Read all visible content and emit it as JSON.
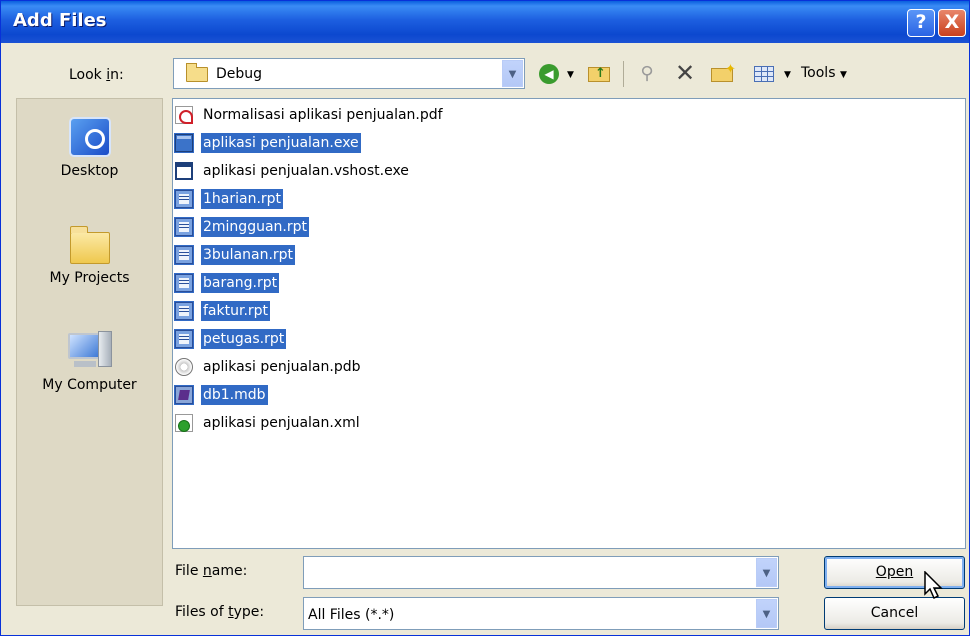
{
  "window": {
    "title": "Add Files"
  },
  "title_buttons": {
    "help": "?",
    "close": "X"
  },
  "look_in": {
    "label_pre": "Look ",
    "label_key": "i",
    "label_post": "n:",
    "value": "Debug"
  },
  "toolbar": {
    "tools_label": "Tools"
  },
  "places": [
    {
      "label": "Desktop",
      "icon": "desktop-icon"
    },
    {
      "label": "My Projects",
      "icon": "folder-icon"
    },
    {
      "label": "My Computer",
      "icon": "computer-icon"
    }
  ],
  "files": [
    {
      "name": "Normalisasi aplikasi penjualan.pdf",
      "type": "pdf",
      "selected": false
    },
    {
      "name": "aplikasi penjualan.exe",
      "type": "exe",
      "selected": true
    },
    {
      "name": "aplikasi penjualan.vshost.exe",
      "type": "vshost",
      "selected": false
    },
    {
      "name": "1harian.rpt",
      "type": "rpt",
      "selected": true
    },
    {
      "name": "2mingguan.rpt",
      "type": "rpt",
      "selected": true
    },
    {
      "name": "3bulanan.rpt",
      "type": "rpt",
      "selected": true
    },
    {
      "name": "barang.rpt",
      "type": "rpt",
      "selected": true
    },
    {
      "name": "faktur.rpt",
      "type": "rpt",
      "selected": true
    },
    {
      "name": "petugas.rpt",
      "type": "rpt",
      "selected": true
    },
    {
      "name": "aplikasi penjualan.pdb",
      "type": "pdb",
      "selected": false
    },
    {
      "name": "db1.mdb",
      "type": "mdb",
      "selected": true
    },
    {
      "name": "aplikasi penjualan.xml",
      "type": "xml",
      "selected": false
    }
  ],
  "file_name": {
    "label_pre": "File ",
    "label_key": "n",
    "label_post": "ame:",
    "value": ""
  },
  "file_type": {
    "label_pre": "Files of ",
    "label_key": "t",
    "label_post": "ype:",
    "value": "All Files (*.*)"
  },
  "buttons": {
    "open": "Open",
    "cancel": "Cancel"
  }
}
